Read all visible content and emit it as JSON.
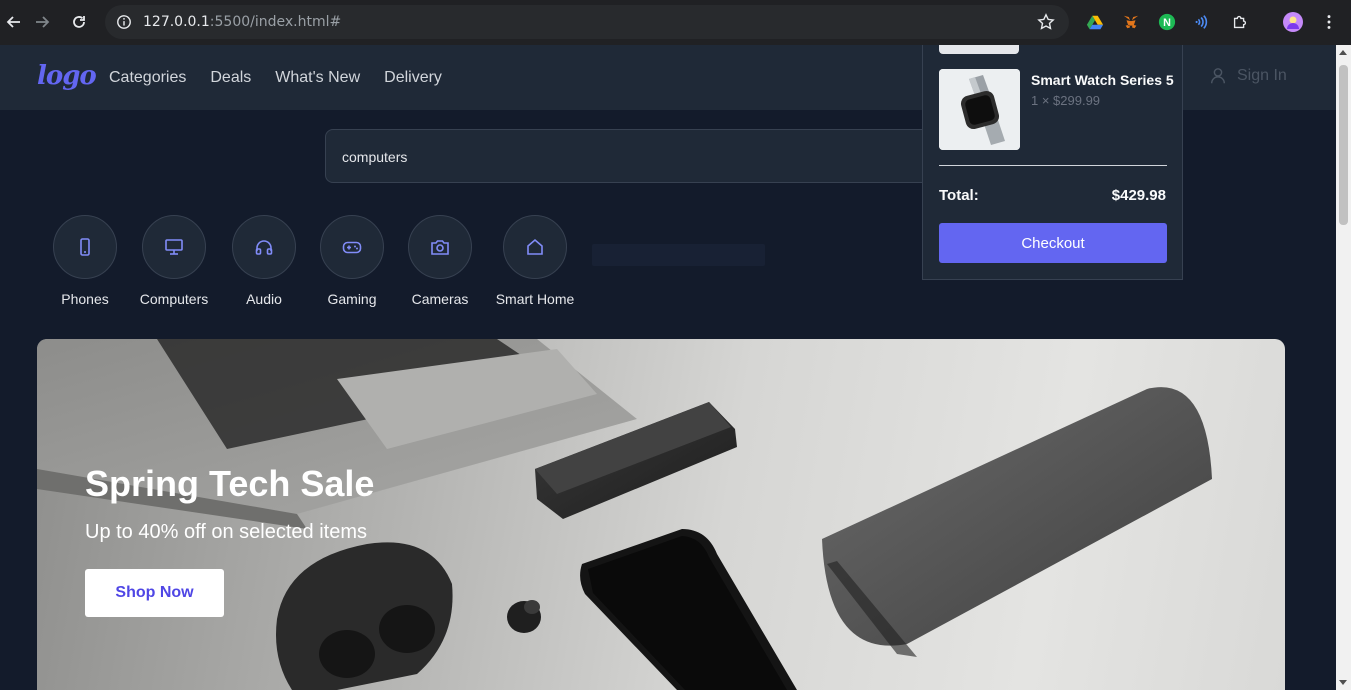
{
  "browser": {
    "url_host": "127.0.0.1",
    "url_path": ":5500/index.html#"
  },
  "header": {
    "logo": "logo",
    "nav": [
      "Categories",
      "Deals",
      "What's New",
      "Delivery"
    ],
    "signin": "Sign In"
  },
  "search": {
    "value": "computers"
  },
  "categories": [
    {
      "label": "Phones",
      "icon": "phone-icon"
    },
    {
      "label": "Computers",
      "icon": "monitor-icon"
    },
    {
      "label": "Audio",
      "icon": "headphones-icon"
    },
    {
      "label": "Gaming",
      "icon": "gamepad-icon"
    },
    {
      "label": "Cameras",
      "icon": "camera-icon"
    },
    {
      "label": "Smart Home",
      "icon": "home-icon"
    }
  ],
  "hero": {
    "title": "Spring Tech Sale",
    "subtitle": "Up to 40% off on selected items",
    "cta": "Shop Now"
  },
  "cart": {
    "item": {
      "name": "Smart Watch Series 5",
      "qty": "1 × $299.99"
    },
    "total_label": "Total:",
    "total_value": "$429.98",
    "checkout": "Checkout"
  },
  "colors": {
    "accent": "#6366f1",
    "page_bg": "#131b2b",
    "panel_bg": "#1f2937"
  }
}
